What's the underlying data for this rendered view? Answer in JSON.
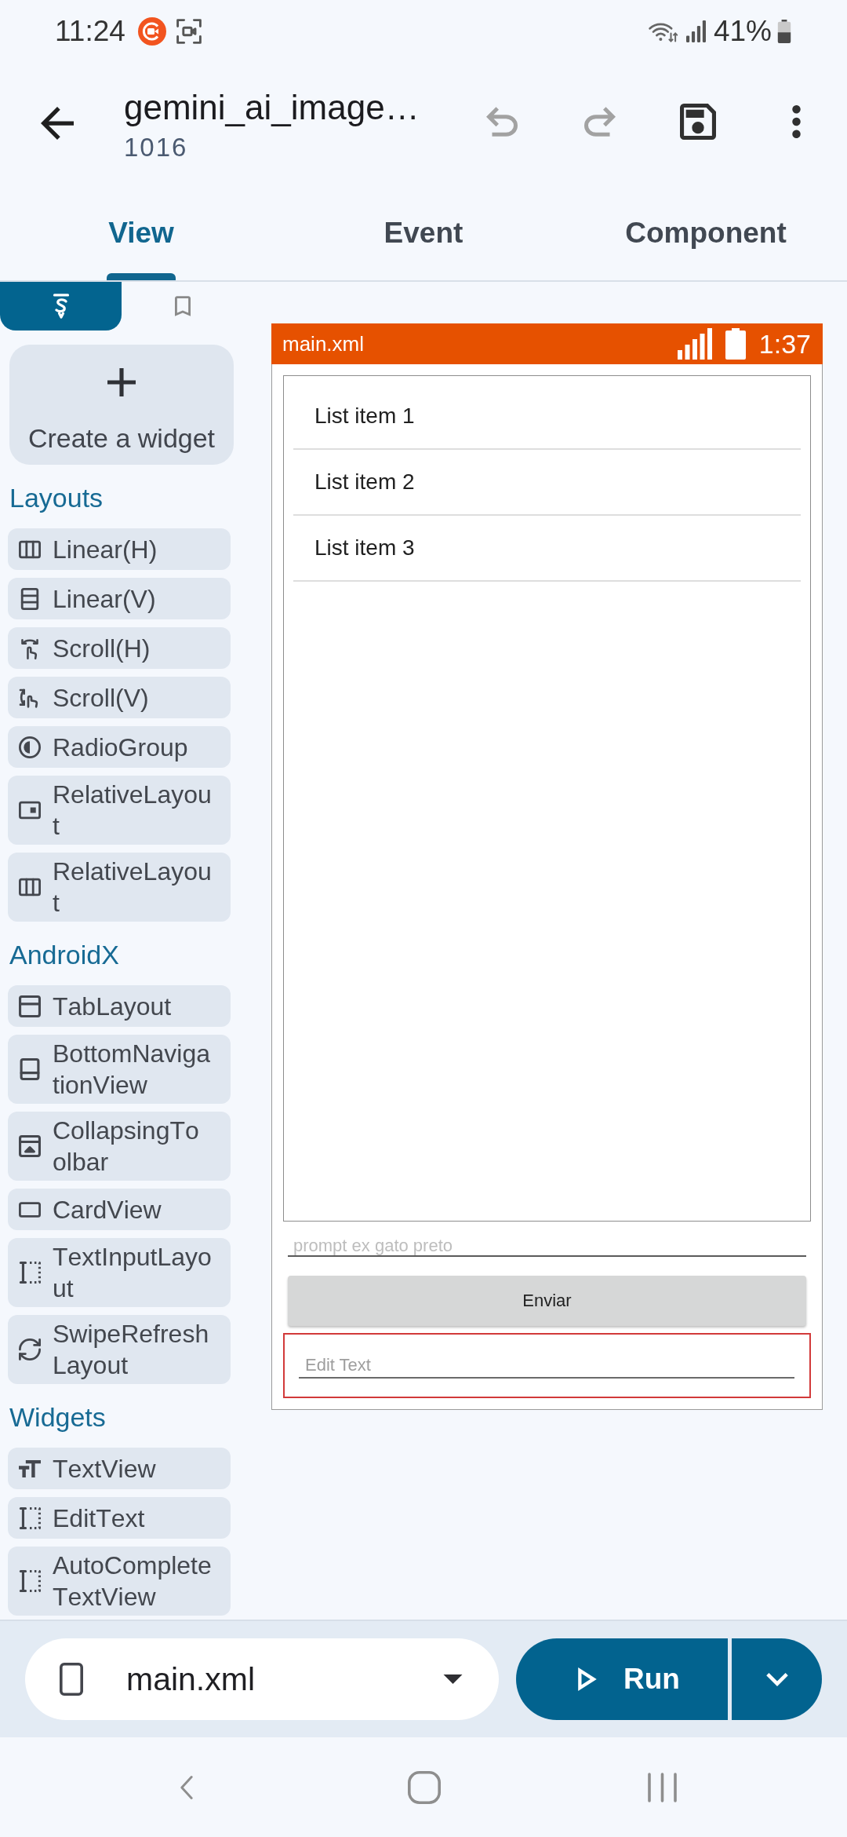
{
  "status_bar": {
    "time": "11:24",
    "battery": "41%"
  },
  "app_bar": {
    "title": "gemini_ai_image…",
    "subtitle": "1016",
    "undo": {
      "disabled": true
    },
    "redo": {
      "disabled": true
    }
  },
  "tabs": [
    {
      "label": "View",
      "selected": true
    },
    {
      "label": "Event",
      "selected": false
    },
    {
      "label": "Component",
      "selected": false
    }
  ],
  "palette": {
    "tabs": [
      {
        "selected": true
      },
      {
        "selected": false
      }
    ],
    "create_button": "Create a widget",
    "sections": [
      {
        "title": "Layouts",
        "items": [
          "Linear(H)",
          "Linear(V)",
          "Scroll(H)",
          "Scroll(V)",
          "RadioGroup",
          "RelativeLayout",
          "RelativeLayout"
        ]
      },
      {
        "title": "AndroidX",
        "items": [
          "TabLayout",
          "BottomNavigationView",
          "CollapsingToolbar",
          "CardView",
          "TextInputLayout",
          "SwipeRefreshLayout"
        ]
      },
      {
        "title": "Widgets",
        "items": [
          "TextView",
          "EditText",
          "AutoCompleteTextView"
        ]
      }
    ]
  },
  "preview": {
    "title": "main.xml",
    "clock": "1:37",
    "list_items": [
      "List item 1",
      "List item 2",
      "List item 3"
    ],
    "prompt_field": {
      "placeholder": "prompt ex gato preto"
    },
    "button": "Enviar",
    "edit_text": {
      "placeholder": "Edit Text",
      "selected": true
    }
  },
  "bottom_bar": {
    "file_selector": {
      "value": "main.xml"
    },
    "run_button": "Run"
  }
}
